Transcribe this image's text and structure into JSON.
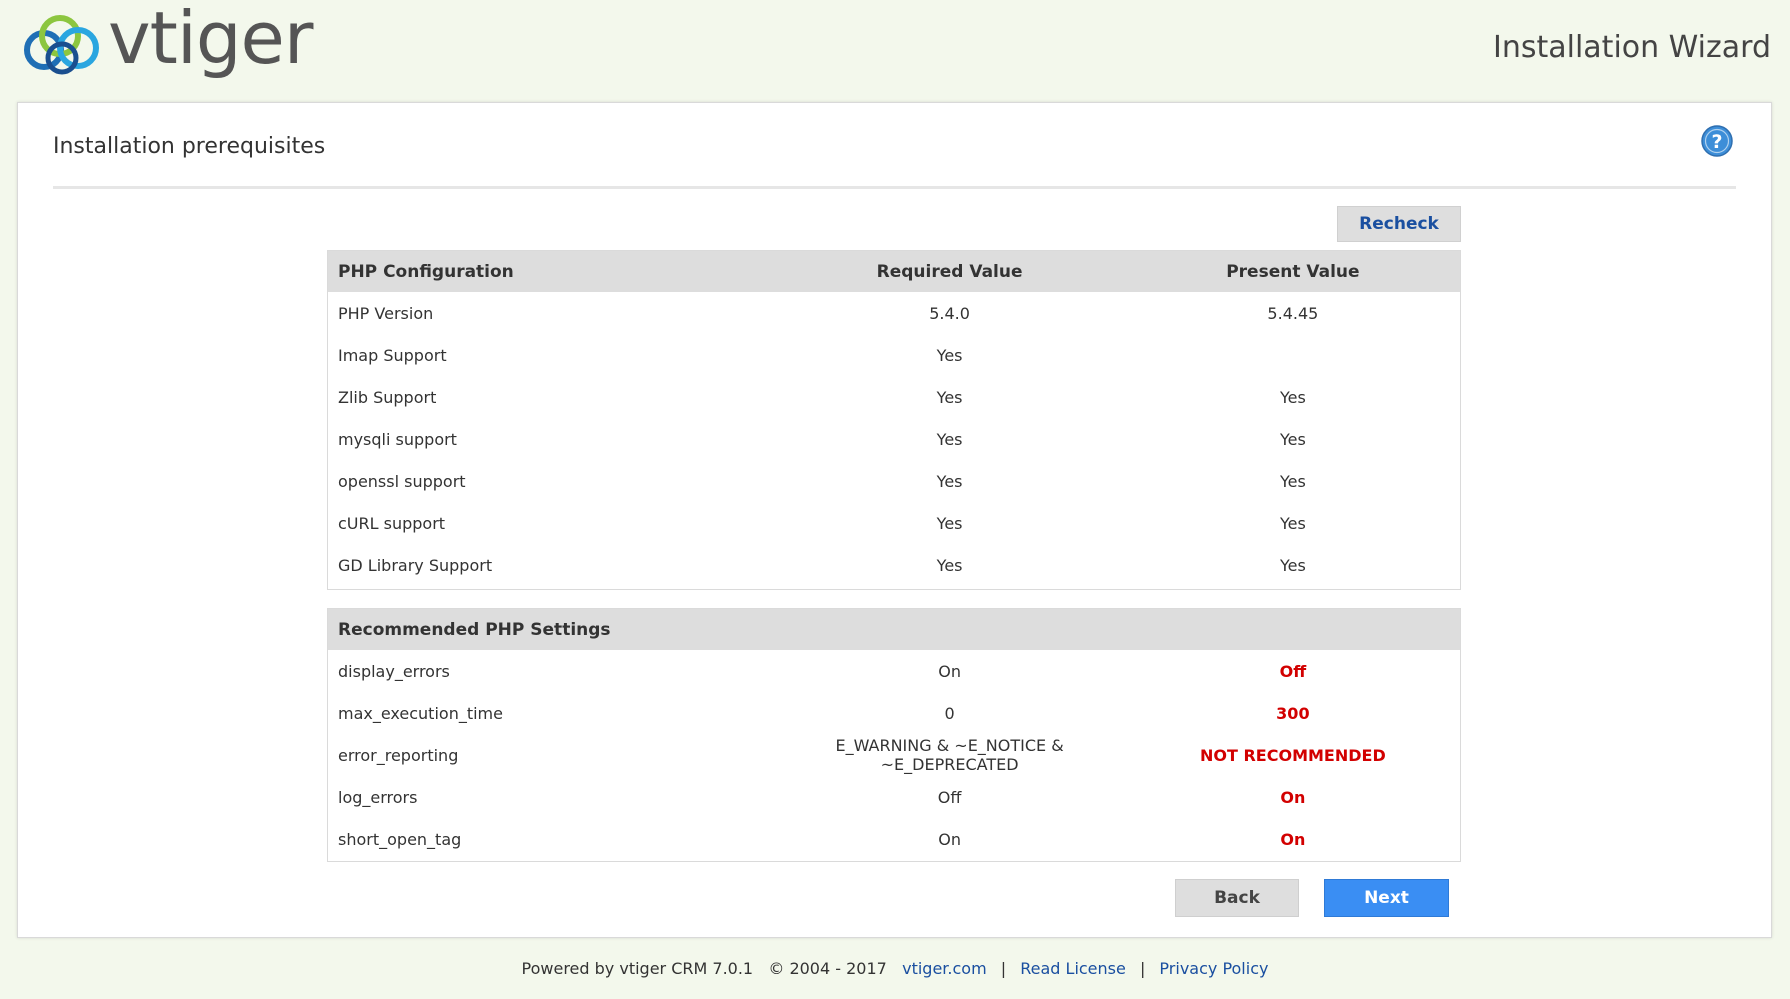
{
  "header": {
    "logo_text": "vtiger",
    "wizard_title": "Installation Wizard"
  },
  "panel": {
    "title": "Installation prerequisites",
    "recheck_label": "Recheck"
  },
  "php_config": {
    "headers": [
      "PHP Configuration",
      "Required Value",
      "Present Value"
    ],
    "rows": [
      {
        "name": "PHP Version",
        "required": "5.4.0",
        "present": "5.4.45"
      },
      {
        "name": "Imap Support",
        "required": "Yes",
        "present": ""
      },
      {
        "name": "Zlib Support",
        "required": "Yes",
        "present": "Yes"
      },
      {
        "name": "mysqli support",
        "required": "Yes",
        "present": "Yes"
      },
      {
        "name": "openssl support",
        "required": "Yes",
        "present": "Yes"
      },
      {
        "name": "cURL support",
        "required": "Yes",
        "present": "Yes"
      },
      {
        "name": "GD Library Support",
        "required": "Yes",
        "present": "Yes"
      }
    ]
  },
  "recommended": {
    "header": "Recommended PHP Settings",
    "rows": [
      {
        "name": "display_errors",
        "required": "On",
        "present": "Off"
      },
      {
        "name": "max_execution_time",
        "required": "0",
        "present": "300"
      },
      {
        "name": "error_reporting",
        "required": "E_WARNING & ~E_NOTICE & ~E_DEPRECATED",
        "present": "NOT RECOMMENDED"
      },
      {
        "name": "log_errors",
        "required": "Off",
        "present": "On"
      },
      {
        "name": "short_open_tag",
        "required": "On",
        "present": "On"
      }
    ]
  },
  "buttons": {
    "back_label": "Back",
    "next_label": "Next"
  },
  "footer": {
    "powered_text": "Powered by vtiger CRM 7.0.1",
    "copyright_text": "© 2004 - 2017",
    "site_link": "vtiger.com",
    "license_link": "Read License",
    "privacy_link": "Privacy Policy",
    "separator": "|"
  },
  "colors": {
    "accent": "#3a8ef3",
    "link": "#1a4fa0",
    "error": "#d20000",
    "background": "#f3f8ec"
  }
}
